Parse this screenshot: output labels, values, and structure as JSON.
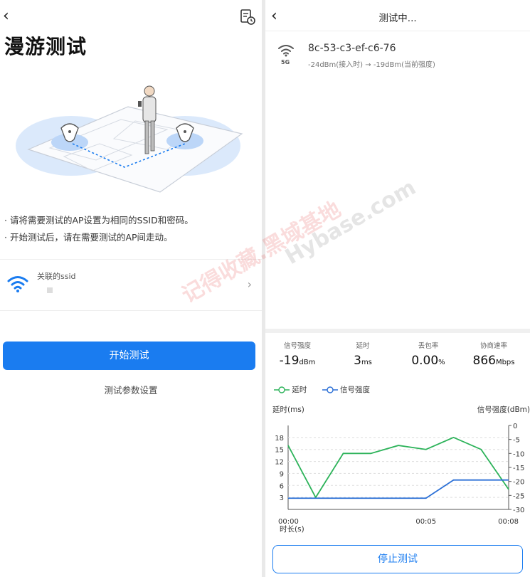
{
  "left": {
    "title": "漫游测试",
    "tips": [
      "· 请将需要测试的AP设置为相同的SSID和密码。",
      "· 开始测试后，请在需要测试的AP间走动。"
    ],
    "ssid": {
      "label": "关联的ssid",
      "value": ""
    },
    "start_button": "开始测试",
    "settings_link": "测试参数设置",
    "icons": {
      "back": "chevron-left-icon",
      "history": "history-icon",
      "wifi": "wifi-icon",
      "next": "chevron-right-icon"
    },
    "accent": "#1a7cf0"
  },
  "right": {
    "title": "测试中...",
    "ap": {
      "band": "5G",
      "mac": "8c-53-c3-ef-c6-76",
      "signal": "-24dBm(接入时) → -19dBm(当前强度)"
    },
    "stats": [
      {
        "label": "信号强度",
        "value": "-19",
        "unit": "dBm"
      },
      {
        "label": "延时",
        "value": "3",
        "unit": "ms"
      },
      {
        "label": "丢包率",
        "value": "0.00",
        "unit": "%"
      },
      {
        "label": "协商速率",
        "value": "866",
        "unit": "Mbps"
      }
    ],
    "stop_button": "停止测试"
  },
  "watermark": {
    "line1": "记得收藏.黑域基地",
    "line2": "Hybase.com"
  },
  "chart_data": {
    "type": "line",
    "legend": [
      "延时",
      "信号强度"
    ],
    "ylabel": "延时(ms)",
    "ylabel_right": "信号强度(dBm)",
    "xlabel": "时长(s)",
    "x_ticks": [
      "00:00",
      "00:05",
      "00:08"
    ],
    "ylim": [
      0,
      21
    ],
    "y_ticks": [
      3,
      6,
      9,
      12,
      15,
      18
    ],
    "y2lim": [
      -30,
      0
    ],
    "y2_ticks": [
      0,
      -5,
      -10,
      -15,
      -20,
      -25,
      -30
    ],
    "series": [
      {
        "name": "延时",
        "color": "#2db35a",
        "axis": "left",
        "x": [
          0,
          1,
          2,
          3,
          4,
          5,
          6,
          7,
          8
        ],
        "values": [
          16,
          3,
          14,
          14,
          16,
          15,
          18,
          15,
          5
        ]
      },
      {
        "name": "信号强度",
        "color": "#2a6fd6",
        "axis": "right",
        "x": [
          0,
          1,
          2,
          3,
          4,
          5,
          6,
          7,
          8
        ],
        "values": [
          -26,
          -26,
          -26,
          -26,
          -26,
          -26,
          -19.5,
          -19.5,
          -19.5
        ]
      }
    ]
  }
}
